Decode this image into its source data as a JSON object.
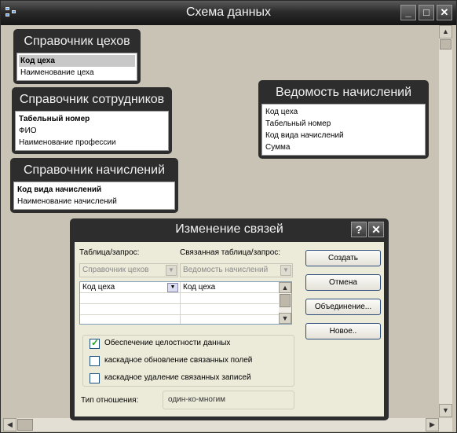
{
  "window": {
    "title": "Схема данных"
  },
  "tables": [
    {
      "title": "Справочник цехов",
      "fields": [
        {
          "name": "Код цеха",
          "key": true,
          "selected": true
        },
        {
          "name": "Наименование цеха",
          "key": false
        }
      ]
    },
    {
      "title": "Справочник сотрудников",
      "fields": [
        {
          "name": "Табельный номер",
          "key": true
        },
        {
          "name": "ФИО",
          "key": false
        },
        {
          "name": "Наименование профессии",
          "key": false
        }
      ]
    },
    {
      "title": "Справочник начислений",
      "fields": [
        {
          "name": "Код вида  начислений",
          "key": true
        },
        {
          "name": "Наименование начислений",
          "key": false
        }
      ]
    },
    {
      "title": "Ведомость начислений",
      "fields": [
        {
          "name": "Код цеха",
          "key": false
        },
        {
          "name": "Табельный номер",
          "key": false
        },
        {
          "name": "Код вида  начислений",
          "key": false
        },
        {
          "name": "Сумма",
          "key": false
        }
      ]
    }
  ],
  "dialog": {
    "title": "Изменение связей",
    "table_label": "Таблица/запрос:",
    "related_label": "Связанная таблица/запрос:",
    "table_value": "Справочник цехов",
    "related_value": "Ведомость начислений",
    "grid_rows": [
      {
        "left": "Код цеха",
        "right": "Код цеха"
      }
    ],
    "options": [
      {
        "label": "Обеспечение целостности данных",
        "checked": true
      },
      {
        "label": "каскадное обновление связанных полей",
        "checked": false
      },
      {
        "label": "каскадное удаление связанных записей",
        "checked": false
      }
    ],
    "relation_type_label": "Тип отношения:",
    "relation_type_value": "один-ко-многим",
    "buttons": {
      "create": "Создать",
      "cancel": "Отмена",
      "join": "Объединение...",
      "new": "Новое.."
    }
  }
}
